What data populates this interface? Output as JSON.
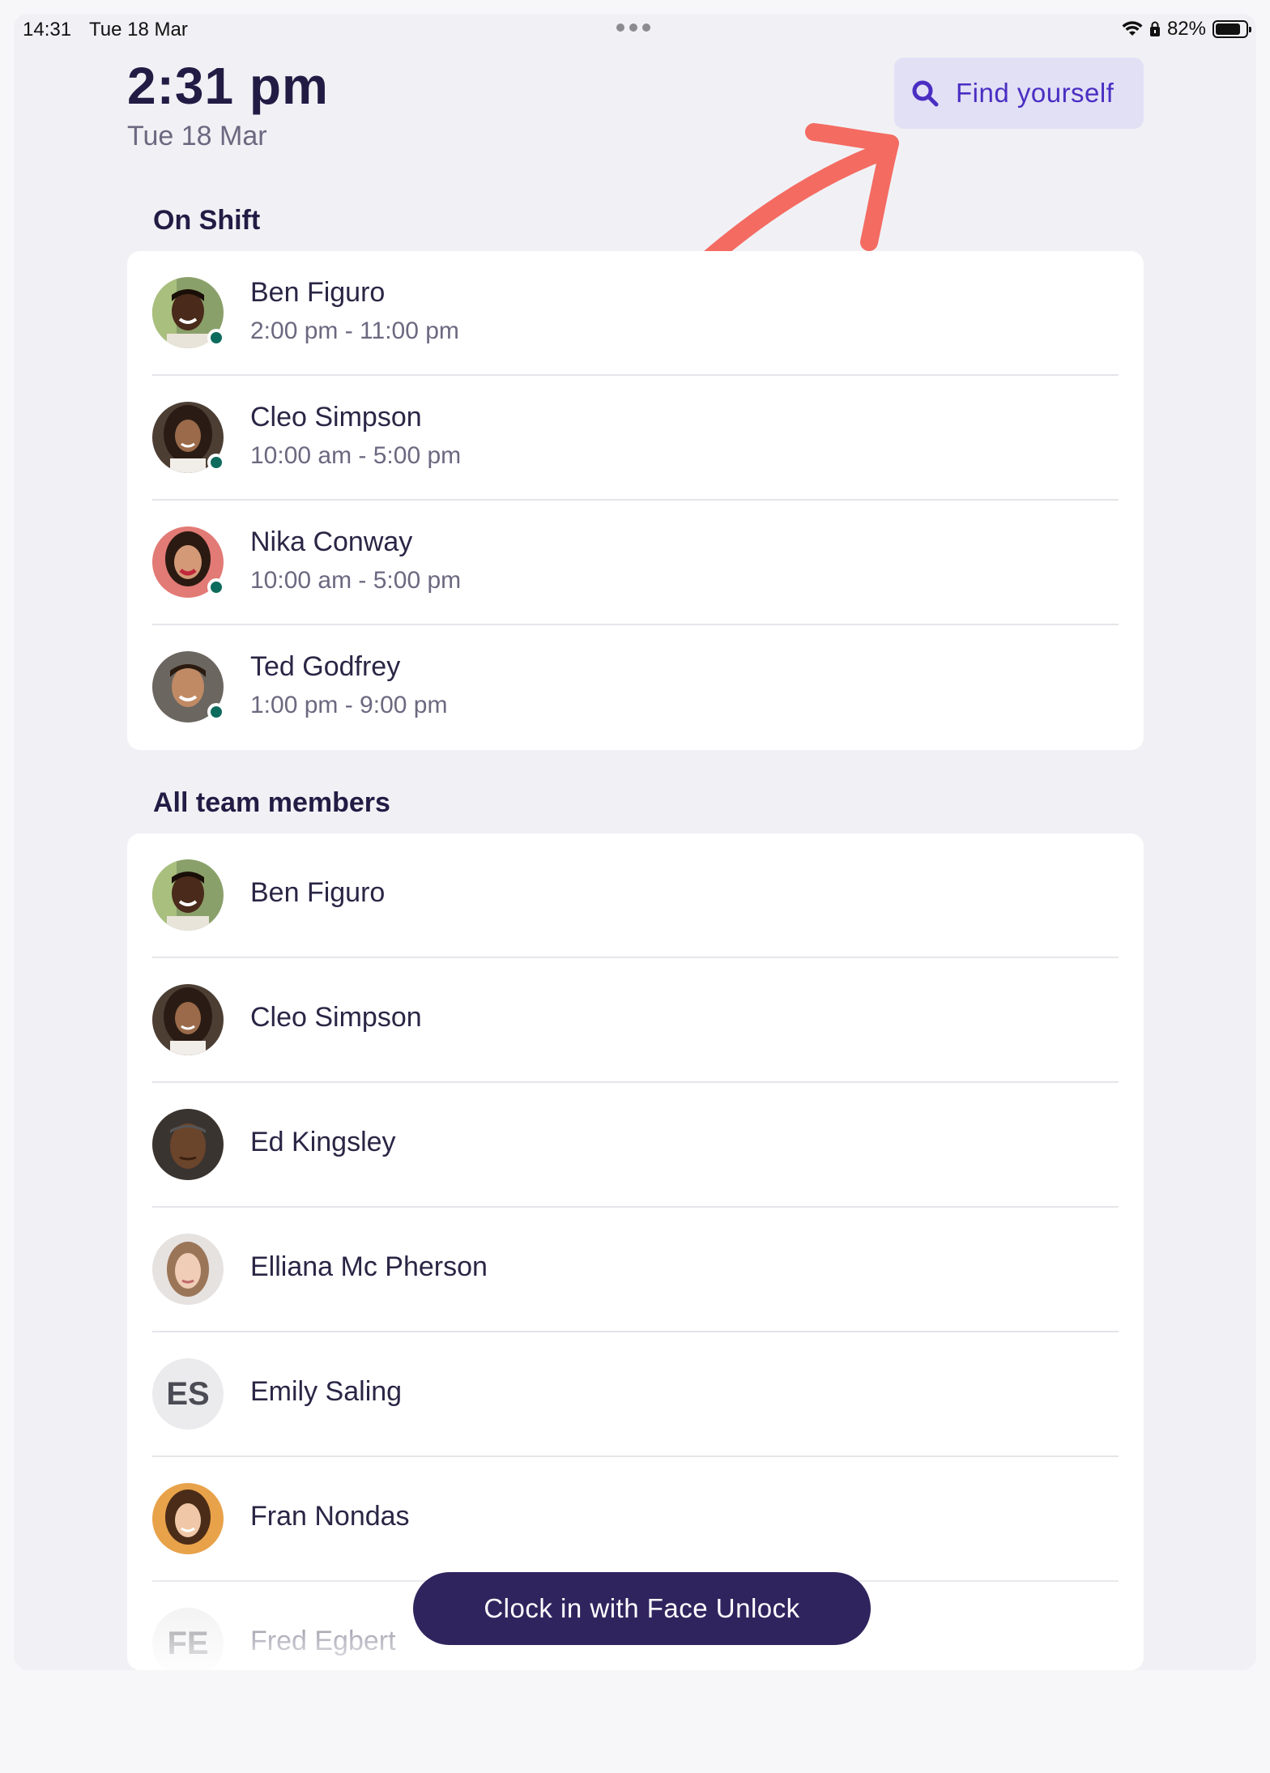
{
  "status_bar": {
    "time": "14:31",
    "date": "Tue 18 Mar",
    "battery_percent": "82%",
    "battery_level": 0.82,
    "icons": [
      "wifi-icon",
      "lock-icon",
      "battery-icon"
    ]
  },
  "header": {
    "clock_time": "2:31 pm",
    "clock_date": "Tue 18 Mar",
    "find_button_label": "Find yourself",
    "find_button_icon": "search-icon"
  },
  "on_shift": {
    "title": "On Shift",
    "members": [
      {
        "name": "Ben Figuro",
        "shift": "2:00 pm - 11:00 pm",
        "online": true
      },
      {
        "name": "Cleo Simpson",
        "shift": "10:00 am - 5:00 pm",
        "online": true
      },
      {
        "name": "Nika Conway",
        "shift": "10:00 am - 5:00 pm",
        "online": true
      },
      {
        "name": "Ted Godfrey",
        "shift": "1:00 pm - 9:00 pm",
        "online": true
      }
    ]
  },
  "all_members": {
    "title": "All team members",
    "members": [
      {
        "name": "Ben Figuro"
      },
      {
        "name": "Cleo Simpson"
      },
      {
        "name": "Ed Kingsley"
      },
      {
        "name": "Elliana Mc Pherson"
      },
      {
        "name": "Emily Saling",
        "initials": "ES"
      },
      {
        "name": "Fran Nondas"
      },
      {
        "name": "Fred Egbert",
        "initials": "FE"
      }
    ]
  },
  "clock_in_button": "Clock in with Face Unlock",
  "colors": {
    "accent": "#4a2ec2",
    "primary_dark": "#30245e",
    "online": "#0d6b5d",
    "annotation_arrow": "#f46b62"
  }
}
